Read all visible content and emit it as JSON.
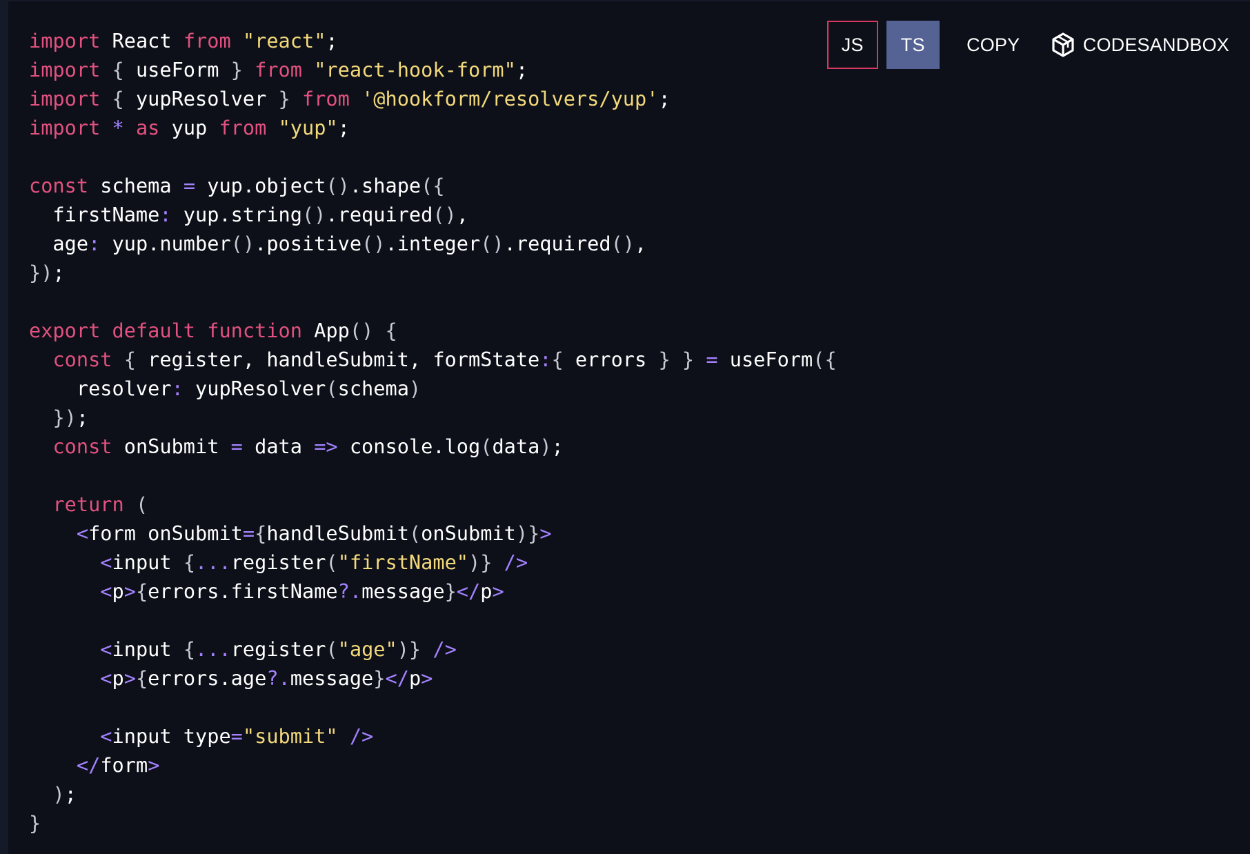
{
  "toolbar": {
    "js_label": "JS",
    "ts_label": "TS",
    "copy_label": "COPY",
    "codesandbox_label": "CODESANDBOX",
    "codesandbox_icon": "codesandbox-cube-icon"
  },
  "colors": {
    "background": "#0d1019",
    "keyword": "#e2517f",
    "string": "#f3d97b",
    "operator": "#a482ff",
    "active_tab": "#546393",
    "js_border": "#d6395f"
  },
  "code": [
    [
      [
        "k",
        "import"
      ],
      [
        "p",
        " React "
      ],
      [
        "k",
        "from"
      ],
      [
        "p",
        " "
      ],
      [
        "s",
        "\"react\""
      ],
      [
        "p",
        ";"
      ]
    ],
    [
      [
        "k",
        "import"
      ],
      [
        "p",
        " "
      ],
      [
        "u",
        "{"
      ],
      [
        "p",
        " useForm "
      ],
      [
        "u",
        "}"
      ],
      [
        "p",
        " "
      ],
      [
        "k",
        "from"
      ],
      [
        "p",
        " "
      ],
      [
        "s",
        "\"react-hook-form\""
      ],
      [
        "p",
        ";"
      ]
    ],
    [
      [
        "k",
        "import"
      ],
      [
        "p",
        " "
      ],
      [
        "u",
        "{"
      ],
      [
        "p",
        " yupResolver "
      ],
      [
        "u",
        "}"
      ],
      [
        "p",
        " "
      ],
      [
        "k",
        "from"
      ],
      [
        "p",
        " "
      ],
      [
        "s",
        "'@hookform/resolvers/yup'"
      ],
      [
        "p",
        ";"
      ]
    ],
    [
      [
        "k",
        "import"
      ],
      [
        "p",
        " "
      ],
      [
        "o",
        "*"
      ],
      [
        "p",
        " "
      ],
      [
        "k",
        "as"
      ],
      [
        "p",
        " yup "
      ],
      [
        "k",
        "from"
      ],
      [
        "p",
        " "
      ],
      [
        "s",
        "\"yup\""
      ],
      [
        "p",
        ";"
      ]
    ],
    [],
    [
      [
        "k",
        "const"
      ],
      [
        "p",
        " schema "
      ],
      [
        "o",
        "="
      ],
      [
        "p",
        " yup.object"
      ],
      [
        "u",
        "()"
      ],
      [
        "p",
        ".shape"
      ],
      [
        "u",
        "({"
      ]
    ],
    [
      [
        "p",
        "  firstName"
      ],
      [
        "o",
        ":"
      ],
      [
        "p",
        " yup.string"
      ],
      [
        "u",
        "()"
      ],
      [
        "p",
        ".required"
      ],
      [
        "u",
        "()"
      ],
      [
        "p",
        ","
      ]
    ],
    [
      [
        "p",
        "  age"
      ],
      [
        "o",
        ":"
      ],
      [
        "p",
        " yup.number"
      ],
      [
        "u",
        "()"
      ],
      [
        "p",
        ".positive"
      ],
      [
        "u",
        "()"
      ],
      [
        "p",
        ".integer"
      ],
      [
        "u",
        "()"
      ],
      [
        "p",
        ".required"
      ],
      [
        "u",
        "()"
      ],
      [
        "p",
        ","
      ]
    ],
    [
      [
        "u",
        "})"
      ],
      [
        "p",
        ";"
      ]
    ],
    [],
    [
      [
        "k",
        "export"
      ],
      [
        "p",
        " "
      ],
      [
        "k",
        "default"
      ],
      [
        "p",
        " "
      ],
      [
        "k",
        "function"
      ],
      [
        "p",
        " App"
      ],
      [
        "u",
        "()"
      ],
      [
        "p",
        " "
      ],
      [
        "u",
        "{"
      ]
    ],
    [
      [
        "p",
        "  "
      ],
      [
        "k",
        "const"
      ],
      [
        "p",
        " "
      ],
      [
        "u",
        "{"
      ],
      [
        "p",
        " register, handleSubmit, formState"
      ],
      [
        "o",
        ":"
      ],
      [
        "u",
        "{"
      ],
      [
        "p",
        " errors "
      ],
      [
        "u",
        "}"
      ],
      [
        "p",
        " "
      ],
      [
        "u",
        "}"
      ],
      [
        "p",
        " "
      ],
      [
        "o",
        "="
      ],
      [
        "p",
        " useForm"
      ],
      [
        "u",
        "({"
      ]
    ],
    [
      [
        "p",
        "    resolver"
      ],
      [
        "o",
        ":"
      ],
      [
        "p",
        " yupResolver"
      ],
      [
        "u",
        "("
      ],
      [
        "p",
        "schema"
      ],
      [
        "u",
        ")"
      ]
    ],
    [
      [
        "p",
        "  "
      ],
      [
        "u",
        "})"
      ],
      [
        "p",
        ";"
      ]
    ],
    [
      [
        "p",
        "  "
      ],
      [
        "k",
        "const"
      ],
      [
        "p",
        " onSubmit "
      ],
      [
        "o",
        "="
      ],
      [
        "p",
        " data "
      ],
      [
        "o",
        "=>"
      ],
      [
        "p",
        " console.log"
      ],
      [
        "u",
        "("
      ],
      [
        "p",
        "data"
      ],
      [
        "u",
        ")"
      ],
      [
        "p",
        ";"
      ]
    ],
    [],
    [
      [
        "p",
        "  "
      ],
      [
        "k",
        "return"
      ],
      [
        "p",
        " "
      ],
      [
        "u",
        "("
      ]
    ],
    [
      [
        "p",
        "    "
      ],
      [
        "o",
        "<"
      ],
      [
        "p",
        "form onSubmit"
      ],
      [
        "o",
        "="
      ],
      [
        "u",
        "{"
      ],
      [
        "p",
        "handleSubmit"
      ],
      [
        "u",
        "("
      ],
      [
        "p",
        "onSubmit"
      ],
      [
        "u",
        ")}"
      ],
      [
        "o",
        ">"
      ]
    ],
    [
      [
        "p",
        "      "
      ],
      [
        "o",
        "<"
      ],
      [
        "p",
        "input "
      ],
      [
        "u",
        "{"
      ],
      [
        "o",
        "..."
      ],
      [
        "p",
        "register"
      ],
      [
        "u",
        "("
      ],
      [
        "s",
        "\"firstName\""
      ],
      [
        "u",
        ")}"
      ],
      [
        "p",
        " "
      ],
      [
        "o",
        "/>"
      ]
    ],
    [
      [
        "p",
        "      "
      ],
      [
        "o",
        "<"
      ],
      [
        "p",
        "p"
      ],
      [
        "o",
        ">"
      ],
      [
        "u",
        "{"
      ],
      [
        "p",
        "errors.firstName"
      ],
      [
        "o",
        "?."
      ],
      [
        "p",
        "message"
      ],
      [
        "u",
        "}"
      ],
      [
        "o",
        "</"
      ],
      [
        "p",
        "p"
      ],
      [
        "o",
        ">"
      ]
    ],
    [],
    [
      [
        "p",
        "      "
      ],
      [
        "o",
        "<"
      ],
      [
        "p",
        "input "
      ],
      [
        "u",
        "{"
      ],
      [
        "o",
        "..."
      ],
      [
        "p",
        "register"
      ],
      [
        "u",
        "("
      ],
      [
        "s",
        "\"age\""
      ],
      [
        "u",
        ")}"
      ],
      [
        "p",
        " "
      ],
      [
        "o",
        "/>"
      ]
    ],
    [
      [
        "p",
        "      "
      ],
      [
        "o",
        "<"
      ],
      [
        "p",
        "p"
      ],
      [
        "o",
        ">"
      ],
      [
        "u",
        "{"
      ],
      [
        "p",
        "errors.age"
      ],
      [
        "o",
        "?."
      ],
      [
        "p",
        "message"
      ],
      [
        "u",
        "}"
      ],
      [
        "o",
        "</"
      ],
      [
        "p",
        "p"
      ],
      [
        "o",
        ">"
      ]
    ],
    [],
    [
      [
        "p",
        "      "
      ],
      [
        "o",
        "<"
      ],
      [
        "p",
        "input type"
      ],
      [
        "o",
        "="
      ],
      [
        "s",
        "\"submit\""
      ],
      [
        "p",
        " "
      ],
      [
        "o",
        "/>"
      ]
    ],
    [
      [
        "p",
        "    "
      ],
      [
        "o",
        "</"
      ],
      [
        "p",
        "form"
      ],
      [
        "o",
        ">"
      ]
    ],
    [
      [
        "p",
        "  "
      ],
      [
        "u",
        ")"
      ],
      [
        "p",
        ";"
      ]
    ],
    [
      [
        "u",
        "}"
      ]
    ]
  ]
}
